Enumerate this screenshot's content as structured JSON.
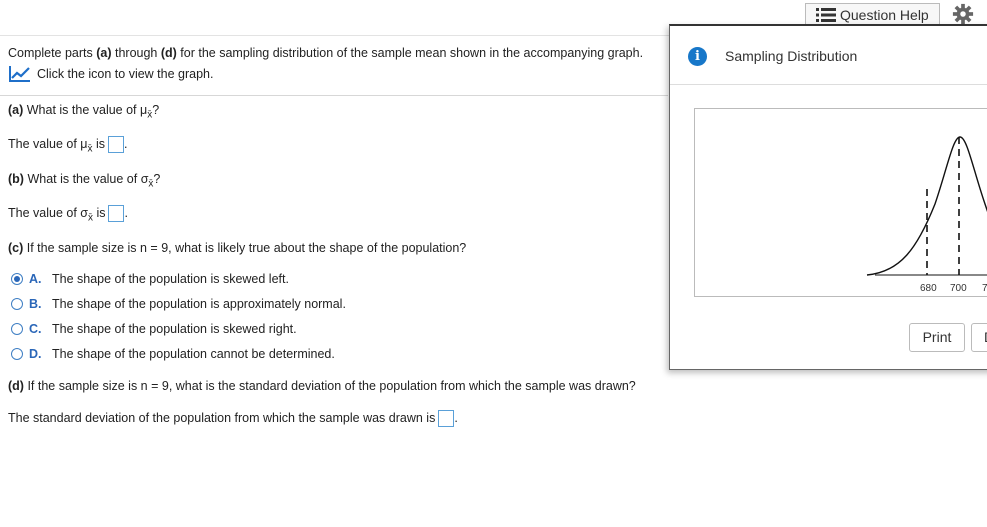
{
  "header": {
    "question_help_label": "Question Help",
    "settings_icon": "gear-icon",
    "list_icon": "list-icon"
  },
  "intro": {
    "line1_pre": "Complete parts ",
    "line1_a": "(a)",
    "line1_mid": " through ",
    "line1_d": "(d)",
    "line1_post": " for the sampling distribution of the sample mean shown in the accompanying graph.",
    "line2": "Click the icon to view the graph.",
    "graph_icon": "line-chart-icon"
  },
  "part_a": {
    "tag": "(a)",
    "question_pre": " What is the value of μ",
    "sub": "x̄",
    "question_post": "?",
    "answer_pre": "The value of μ",
    "answer_post": " is",
    "answer_value": ""
  },
  "part_b": {
    "tag": "(b)",
    "question_pre": " What is the value of σ",
    "sub": "x̄",
    "question_post": "?",
    "answer_pre": "The value of σ",
    "answer_post": " is",
    "answer_value": ""
  },
  "part_c": {
    "tag": "(c)",
    "question": " If the sample size is n = 9, what is likely true about the shape of the population?",
    "options": [
      {
        "letter": "A.",
        "text": "The shape of the population is skewed left.",
        "selected": true
      },
      {
        "letter": "B.",
        "text": "The shape of the population is approximately normal.",
        "selected": false
      },
      {
        "letter": "C.",
        "text": "The shape of the population is skewed right.",
        "selected": false
      },
      {
        "letter": "D.",
        "text": "The shape of the population cannot be determined.",
        "selected": false
      }
    ]
  },
  "part_d": {
    "tag": "(d)",
    "question": " If the sample size is n = 9, what is the standard deviation of the population from which the sample was drawn?",
    "answer_pre": "The standard deviation of the population from which the sample was drawn is",
    "answer_value": ""
  },
  "popup": {
    "title": "Sampling Distribution",
    "info_icon": "i",
    "ticks": [
      "680",
      "700",
      "7"
    ],
    "print_label": "Print",
    "done_label": "D"
  }
}
